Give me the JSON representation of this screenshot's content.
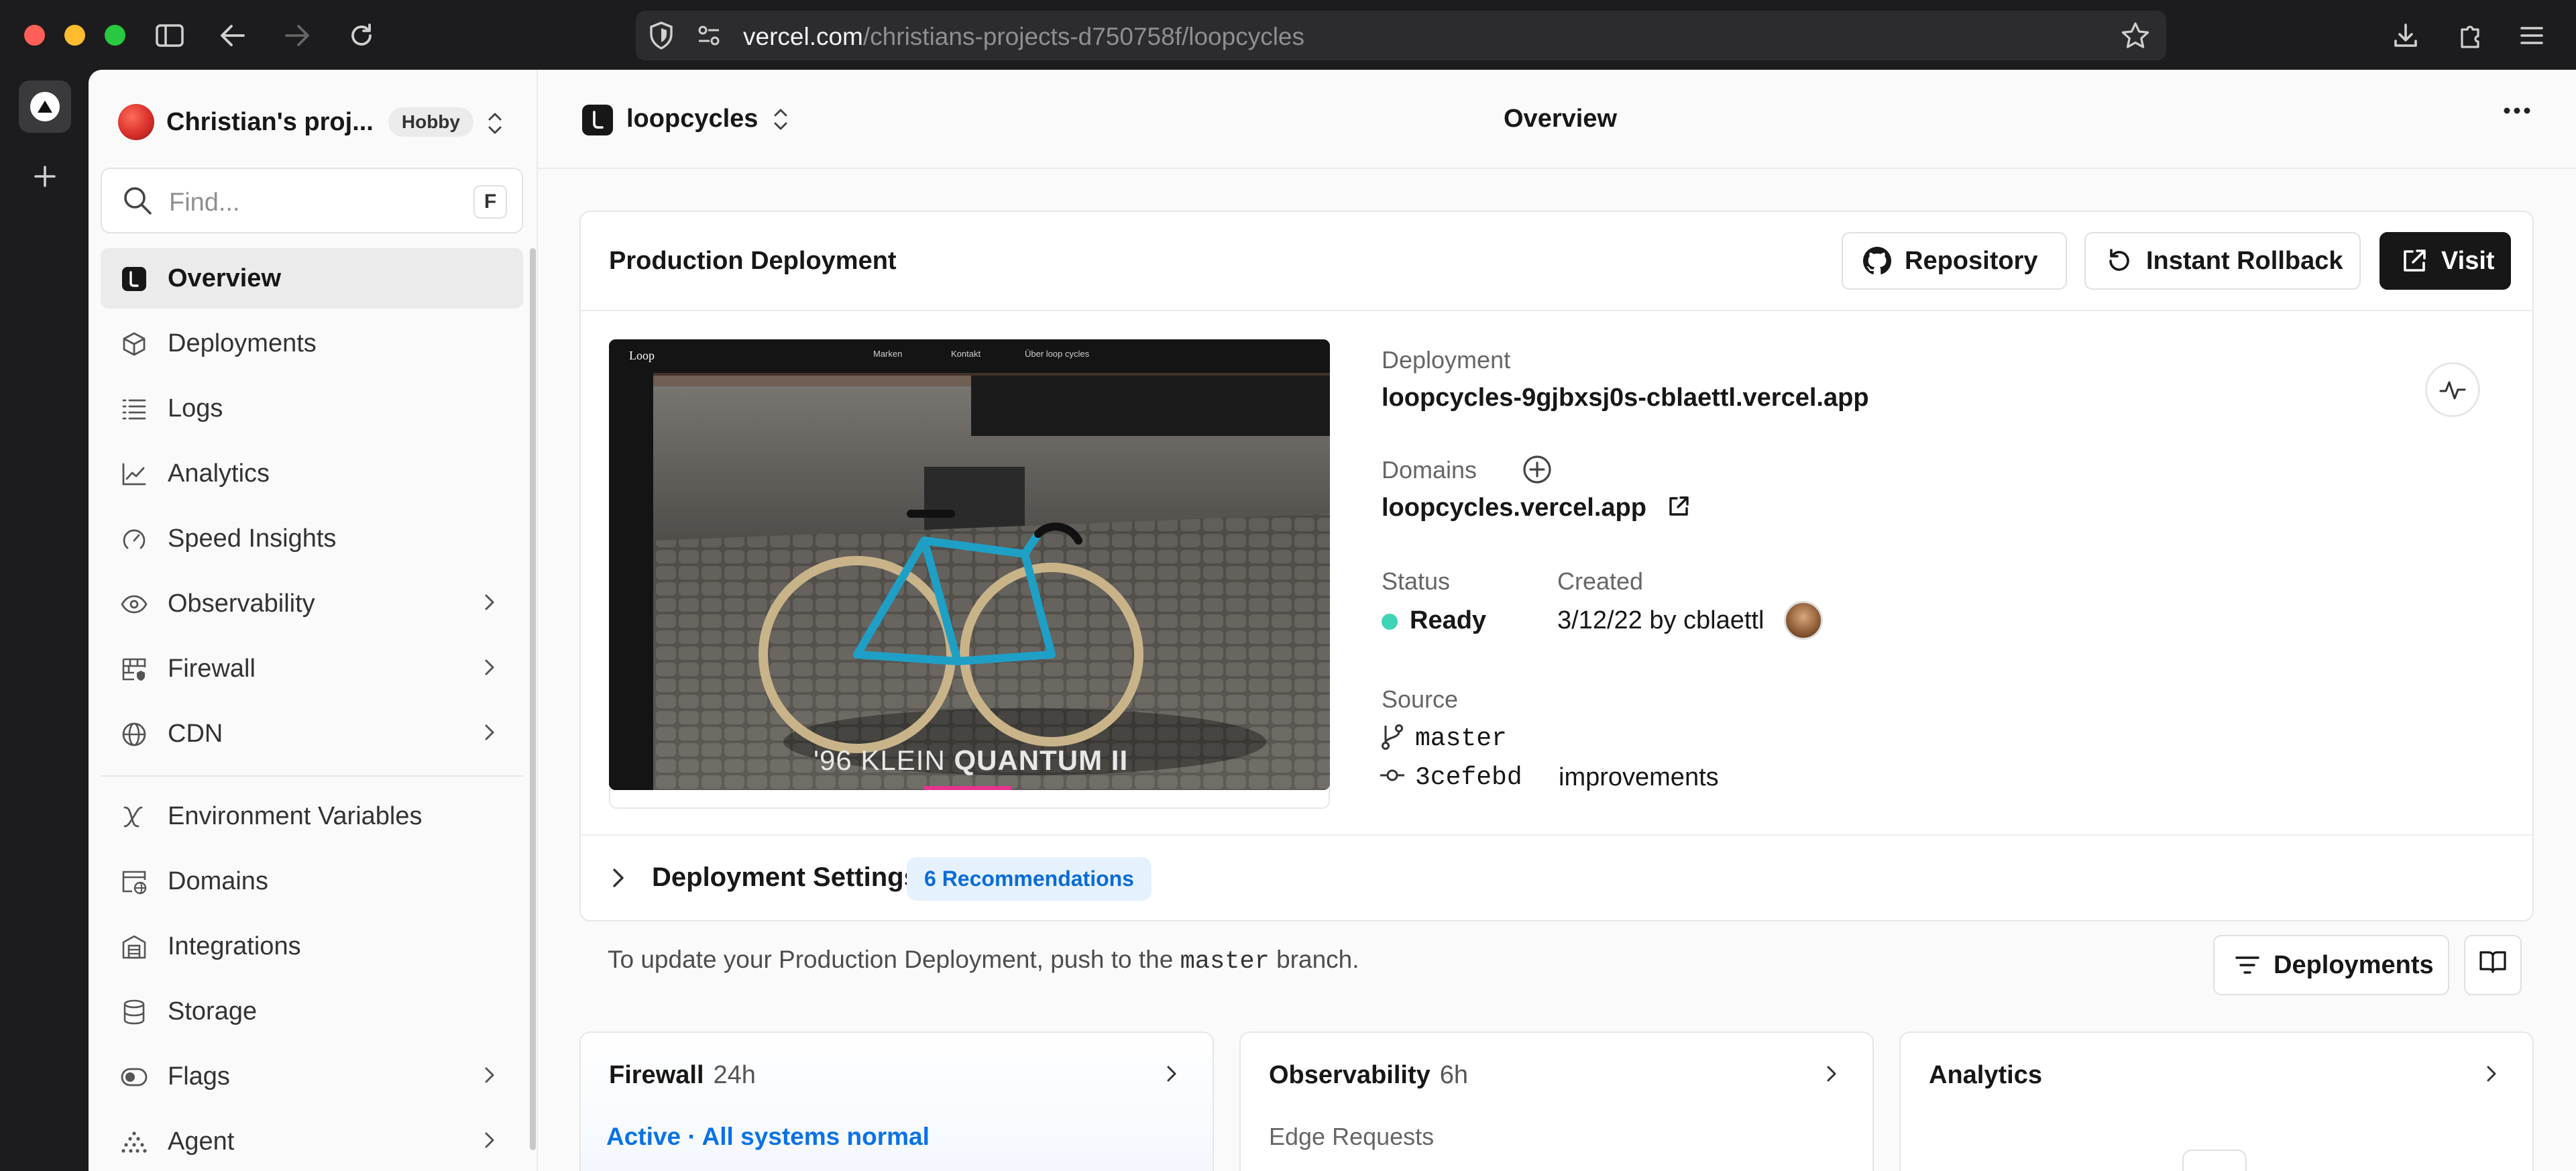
{
  "browser": {
    "url_host": "vercel.com",
    "url_path": "/christians-projects-d750758f/loopcycles"
  },
  "sidebar": {
    "team_name": "Christian's proj...",
    "plan_badge": "Hobby",
    "find_placeholder": "Find...",
    "find_shortcut": "F",
    "items": [
      {
        "label": "Overview",
        "icon": "overview-icon"
      },
      {
        "label": "Deployments",
        "icon": "cube-icon"
      },
      {
        "label": "Logs",
        "icon": "list-icon"
      },
      {
        "label": "Analytics",
        "icon": "chart-icon"
      },
      {
        "label": "Speed Insights",
        "icon": "gauge-icon"
      },
      {
        "label": "Observability",
        "icon": "eye-icon"
      },
      {
        "label": "Firewall",
        "icon": "firewall-icon"
      },
      {
        "label": "CDN",
        "icon": "globe-icon"
      },
      {
        "label": "Environment Variables",
        "icon": "variables-icon"
      },
      {
        "label": "Domains",
        "icon": "domain-icon"
      },
      {
        "label": "Integrations",
        "icon": "integrations-icon"
      },
      {
        "label": "Storage",
        "icon": "database-icon"
      },
      {
        "label": "Flags",
        "icon": "toggle-icon"
      },
      {
        "label": "Agent",
        "icon": "agent-icon"
      }
    ]
  },
  "header": {
    "project_name": "loopcycles",
    "page_title": "Overview"
  },
  "production": {
    "title": "Production Deployment",
    "repository_label": "Repository",
    "rollback_label": "Instant Rollback",
    "visit_label": "Visit",
    "preview": {
      "logo": "Loop",
      "nav": [
        "Marken",
        "Kontakt",
        "Über loop cycles"
      ],
      "caption_light": "'96 KLEIN",
      "caption_bold": "QUANTUM II"
    },
    "deployment_label": "Deployment",
    "deployment_url": "loopcycles-9gjbxsj0s-cblaettl.vercel.app",
    "domains_label": "Domains",
    "domain": "loopcycles.vercel.app",
    "status_label": "Status",
    "status_value": "Ready",
    "created_label": "Created",
    "created_value": "3/12/22 by cblaettl",
    "source_label": "Source",
    "branch": "master",
    "commit_hash": "3cefebd",
    "commit_message": "improvements",
    "settings_label": "Deployment Settings",
    "recommendations": "6 Recommendations",
    "status_color": "#3fd4b6"
  },
  "update_note": {
    "before": "To update your Production Deployment, push to the",
    "branch": "master",
    "after": "branch."
  },
  "deployments_button": "Deployments",
  "cards": {
    "firewall": {
      "title": "Firewall",
      "range": "24h",
      "status": "Active · All systems normal"
    },
    "observability": {
      "title": "Observability",
      "range": "6h",
      "metric": "Edge Requests"
    },
    "analytics": {
      "title": "Analytics"
    }
  }
}
